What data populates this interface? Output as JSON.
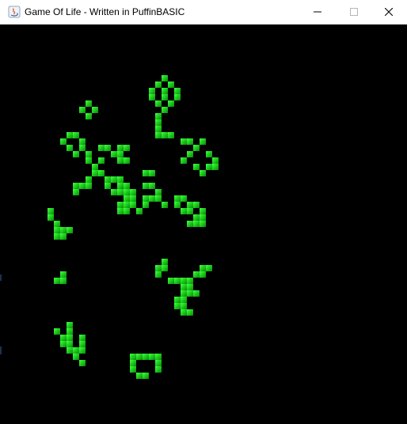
{
  "window": {
    "title": "Game Of Life - Written in PuffinBASIC",
    "controls": {
      "minimize_icon": "minimize-icon",
      "maximize_icon": "maximize-icon",
      "close_icon": "close-icon"
    }
  },
  "game": {
    "background_color": "#000000",
    "cell_color": "#1ed11e",
    "live_cells": [
      [
        26,
        12
      ],
      [
        25,
        13
      ],
      [
        27,
        13
      ],
      [
        24,
        14
      ],
      [
        26,
        14
      ],
      [
        28,
        14
      ],
      [
        24,
        15
      ],
      [
        26,
        15
      ],
      [
        28,
        15
      ],
      [
        25,
        16
      ],
      [
        27,
        16
      ],
      [
        26,
        17
      ],
      [
        25,
        18
      ],
      [
        25,
        19
      ],
      [
        25,
        20
      ],
      [
        25,
        21
      ],
      [
        26,
        21
      ],
      [
        27,
        21
      ],
      [
        14,
        16
      ],
      [
        13,
        17
      ],
      [
        15,
        17
      ],
      [
        14,
        18
      ],
      [
        11,
        21
      ],
      [
        12,
        21
      ],
      [
        10,
        22
      ],
      [
        11,
        23
      ],
      [
        12,
        24
      ],
      [
        13,
        22
      ],
      [
        13,
        23
      ],
      [
        14,
        24
      ],
      [
        14,
        25
      ],
      [
        15,
        26
      ],
      [
        16,
        23
      ],
      [
        17,
        23
      ],
      [
        18,
        24
      ],
      [
        16,
        25
      ],
      [
        19,
        23
      ],
      [
        20,
        23
      ],
      [
        19,
        24
      ],
      [
        19,
        25
      ],
      [
        20,
        25
      ],
      [
        29,
        22
      ],
      [
        30,
        22
      ],
      [
        31,
        23
      ],
      [
        30,
        24
      ],
      [
        29,
        25
      ],
      [
        32,
        22
      ],
      [
        31,
        26
      ],
      [
        33,
        26
      ],
      [
        32,
        27
      ],
      [
        33,
        24
      ],
      [
        34,
        25
      ],
      [
        34,
        26
      ],
      [
        15,
        27
      ],
      [
        14,
        28
      ],
      [
        12,
        29
      ],
      [
        13,
        29
      ],
      [
        14,
        29
      ],
      [
        12,
        30
      ],
      [
        16,
        27
      ],
      [
        17,
        28
      ],
      [
        18,
        28
      ],
      [
        19,
        28
      ],
      [
        17,
        29
      ],
      [
        19,
        29
      ],
      [
        20,
        29
      ],
      [
        18,
        30
      ],
      [
        19,
        30
      ],
      [
        20,
        30
      ],
      [
        21,
        30
      ],
      [
        20,
        31
      ],
      [
        21,
        31
      ],
      [
        19,
        32
      ],
      [
        20,
        32
      ],
      [
        21,
        32
      ],
      [
        19,
        33
      ],
      [
        20,
        33
      ],
      [
        23,
        27
      ],
      [
        24,
        27
      ],
      [
        23,
        29
      ],
      [
        24,
        29
      ],
      [
        25,
        30
      ],
      [
        23,
        31
      ],
      [
        24,
        31
      ],
      [
        25,
        31
      ],
      [
        23,
        32
      ],
      [
        26,
        32
      ],
      [
        22,
        33
      ],
      [
        28,
        31
      ],
      [
        29,
        31
      ],
      [
        28,
        32
      ],
      [
        30,
        32
      ],
      [
        29,
        33
      ],
      [
        30,
        32
      ],
      [
        31,
        32
      ],
      [
        29,
        33
      ],
      [
        30,
        33
      ],
      [
        32,
        33
      ],
      [
        31,
        34
      ],
      [
        32,
        34
      ],
      [
        30,
        35
      ],
      [
        31,
        35
      ],
      [
        32,
        35
      ],
      [
        8,
        33
      ],
      [
        8,
        34
      ],
      [
        9,
        35
      ],
      [
        9,
        36
      ],
      [
        10,
        36
      ],
      [
        9,
        37
      ],
      [
        10,
        37
      ],
      [
        11,
        36
      ],
      [
        8,
        34
      ],
      [
        10,
        43
      ],
      [
        9,
        44
      ],
      [
        10,
        44
      ],
      [
        26,
        41
      ],
      [
        25,
        42
      ],
      [
        26,
        42
      ],
      [
        25,
        43
      ],
      [
        32,
        42
      ],
      [
        33,
        42
      ],
      [
        31,
        43
      ],
      [
        32,
        43
      ],
      [
        27,
        44
      ],
      [
        28,
        44
      ],
      [
        29,
        44
      ],
      [
        30,
        44
      ],
      [
        29,
        45
      ],
      [
        30,
        45
      ],
      [
        29,
        46
      ],
      [
        30,
        46
      ],
      [
        29,
        47
      ],
      [
        28,
        47
      ],
      [
        29,
        48
      ],
      [
        28,
        48
      ],
      [
        29,
        49
      ],
      [
        30,
        49
      ],
      [
        31,
        46
      ],
      [
        9,
        52
      ],
      [
        10,
        53
      ],
      [
        11,
        53
      ],
      [
        10,
        54
      ],
      [
        11,
        54
      ],
      [
        11,
        55
      ],
      [
        12,
        55
      ],
      [
        12,
        56
      ],
      [
        13,
        57
      ],
      [
        11,
        51
      ],
      [
        11,
        52
      ],
      [
        11,
        53
      ],
      [
        13,
        53
      ],
      [
        13,
        54
      ],
      [
        13,
        55
      ],
      [
        21,
        56
      ],
      [
        22,
        56
      ],
      [
        23,
        56
      ],
      [
        24,
        56
      ],
      [
        25,
        56
      ],
      [
        25,
        57
      ],
      [
        21,
        57
      ],
      [
        25,
        58
      ],
      [
        21,
        58
      ],
      [
        22,
        59
      ],
      [
        23,
        59
      ],
      [
        21,
        58
      ]
    ]
  }
}
